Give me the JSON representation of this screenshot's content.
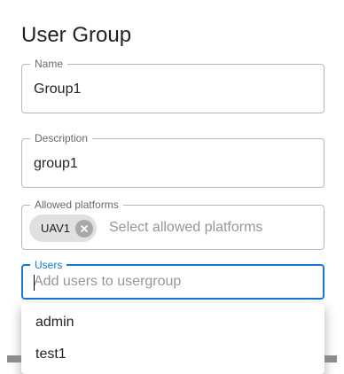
{
  "dialog": {
    "title": "User Group"
  },
  "fields": {
    "name": {
      "label": "Name",
      "value": "Group1"
    },
    "description": {
      "label": "Description",
      "value": "group1"
    },
    "allowed_platforms": {
      "label": "Allowed platforms",
      "chips": [
        "UAV1"
      ],
      "placeholder": "Select allowed platforms"
    },
    "users": {
      "label": "Users",
      "value": "",
      "placeholder": "Add users to usergroup"
    }
  },
  "users_options": [
    "admin",
    "test1"
  ],
  "colors": {
    "accent": "#1976d2",
    "chip_bg": "#e0e0e0",
    "border": "#c4c4c4"
  },
  "icons": {
    "chip_delete": "cancel-circle-icon"
  }
}
